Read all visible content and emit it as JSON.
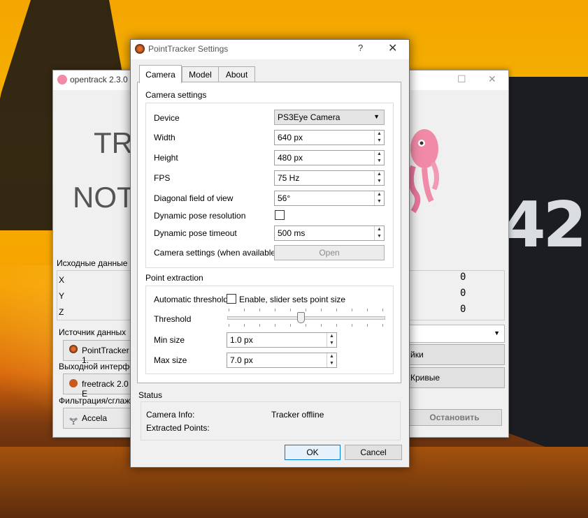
{
  "background": {
    "tail_number": "42"
  },
  "main_window": {
    "title": "opentrack 2.3.0 ::",
    "big_text_line1": "TRA",
    "big_text_line2": "NOT",
    "raw_data_label": "Исходные данные",
    "axes": [
      "X",
      "Y",
      "Z"
    ],
    "input_label": "Источник данных",
    "input_value": "PointTracker 1.",
    "output_label": "Выходной интерфей",
    "output_value": "freetrack 2.0 E",
    "filter_label": "Фильтрация/сглажи",
    "filter_value": "Accela",
    "settings_button": "йки",
    "curves_button": "Кривые",
    "stop_button": "Остановить",
    "zeros": [
      "0",
      "0",
      "0"
    ]
  },
  "dialog": {
    "title": "PointTracker Settings",
    "help": "?",
    "tabs": [
      "Camera",
      "Model",
      "About"
    ],
    "active_tab": "Camera",
    "camera_settings": {
      "group_title": "Camera settings",
      "device_label": "Device",
      "device_value": "PS3Eye Camera",
      "width_label": "Width",
      "width_value": "640 px",
      "height_label": "Height",
      "height_value": "480 px",
      "fps_label": "FPS",
      "fps_value": "75 Hz",
      "fov_label": "Diagonal field of view",
      "fov_value": "56°",
      "dyn_res_label": "Dynamic pose resolution",
      "dyn_timeout_label": "Dynamic pose timeout",
      "dyn_timeout_value": "500 ms",
      "cam_settings_label": "Camera settings (when available)",
      "open_button": "Open"
    },
    "point_extraction": {
      "group_title": "Point extraction",
      "auto_threshold_label": "Automatic threshold",
      "auto_threshold_checkbox": "Enable, slider sets point size",
      "threshold_label": "Threshold",
      "threshold_fraction": 0.47,
      "min_size_label": "Min size",
      "min_size_value": "1.0 px",
      "max_size_label": "Max size",
      "max_size_value": "7.0 px"
    },
    "status": {
      "group_title": "Status",
      "camera_info_label": "Camera Info:",
      "camera_info_value": "Tracker offline",
      "extracted_points_label": "Extracted Points:"
    },
    "ok_button": "OK",
    "cancel_button": "Cancel"
  }
}
